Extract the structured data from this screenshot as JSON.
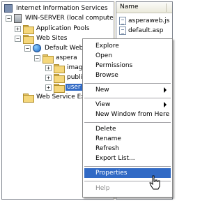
{
  "tree": {
    "root_label": "Internet Information Services",
    "server_label": "WIN-SERVER (local computer)",
    "app_pools_label": "Application Pools",
    "web_sites_label": "Web Sites",
    "default_web_label": "Default Web",
    "aspera_label": "aspera",
    "images_label": "image",
    "public_label": "public",
    "user_label": "user",
    "web_service_ext_label": "Web Service Exte"
  },
  "list": {
    "header": "Name",
    "items": [
      "asperaweb.js",
      "default.asp"
    ]
  },
  "menu": {
    "explore": "Explore",
    "open": "Open",
    "permissions": "Permissions",
    "browse": "Browse",
    "new": "New",
    "view": "View",
    "new_window": "New Window from Here",
    "delete": "Delete",
    "rename": "Rename",
    "refresh": "Refresh",
    "export_list": "Export List...",
    "properties": "Properties",
    "help": "Help"
  },
  "expander": {
    "plus": "+",
    "minus": "−"
  },
  "colors": {
    "selection": "#316ac5",
    "folder": "#f5d77b"
  }
}
